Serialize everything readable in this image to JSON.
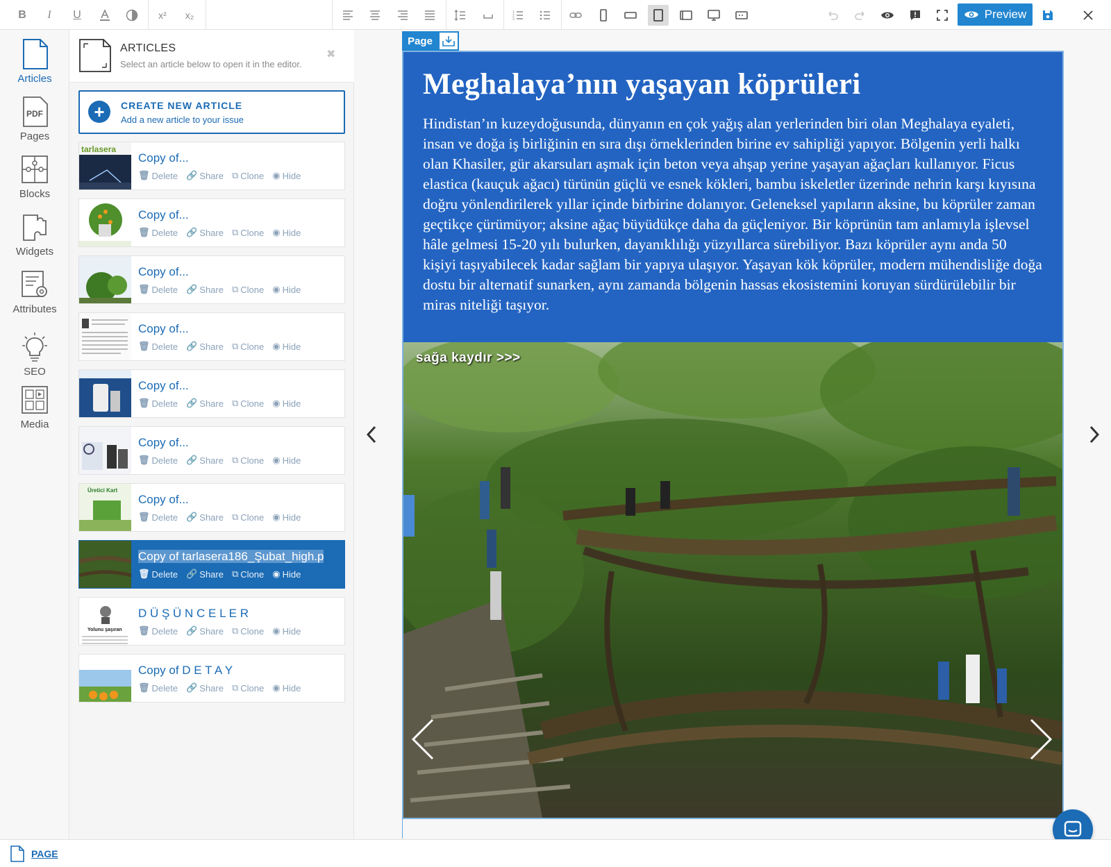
{
  "toolbar": {
    "preview_label": "Preview",
    "colors": {
      "accent": "#2185d0",
      "icon": "#8a8a8a"
    },
    "icons": [
      "bold-icon",
      "italic-icon",
      "underline-icon",
      "font-color-icon",
      "highlight-icon",
      "superscript-icon",
      "subscript-icon",
      "align-left-icon",
      "align-center-icon",
      "align-right-icon",
      "align-justify-icon",
      "line-height-icon",
      "spacing-icon",
      "ordered-list-icon",
      "bullet-list-icon",
      "link-icon",
      "phone-portrait-icon",
      "phone-landscape-icon",
      "tablet-portrait-icon",
      "tablet-landscape-icon",
      "desktop-icon",
      "other-device-icon",
      "undo-icon",
      "redo-icon",
      "eye-icon",
      "comment-icon",
      "fullscreen-icon",
      "save-icon",
      "close-icon"
    ]
  },
  "sidebar": {
    "items": [
      {
        "label": "Articles",
        "icon": "article-doc-icon",
        "active": true
      },
      {
        "label": "Pages",
        "icon": "pdf-icon"
      },
      {
        "label": "Blocks",
        "icon": "puzzle-icon"
      },
      {
        "label": "Widgets",
        "icon": "widget-icon"
      },
      {
        "label": "Attributes",
        "icon": "attributes-icon"
      },
      {
        "label": "SEO",
        "icon": "lightbulb-icon"
      },
      {
        "label": "Media",
        "icon": "media-icon"
      }
    ]
  },
  "articles": {
    "title": "ARTICLES",
    "subtitle": "Select an article below to open it in the editor.",
    "create_title": "CREATE NEW ARTICLE",
    "create_subtitle": "Add a new article to your issue",
    "actions": {
      "delete": "Delete",
      "share": "Share",
      "clone": "Clone",
      "hide": "Hide"
    },
    "items": [
      {
        "name": "Copy of...",
        "thumb": "night-lightning"
      },
      {
        "name": "Copy of...",
        "thumb": "orange-tree"
      },
      {
        "name": "Copy of...",
        "thumb": "green-tree"
      },
      {
        "name": "Copy of...",
        "thumb": "text-page"
      },
      {
        "name": "Copy of...",
        "thumb": "blue-product"
      },
      {
        "name": "Copy of...",
        "thumb": "machine-page"
      },
      {
        "name": "Copy of...",
        "thumb": "green-product"
      },
      {
        "name": "Copy of tarlasera186_Şubat_high.p",
        "thumb": "root-bridge",
        "selected": true
      },
      {
        "name": "D Ü Ş Ü N C E L E R",
        "thumb": "text-portrait"
      },
      {
        "name": "Copy of D E T A Y",
        "thumb": "oranges-sky"
      }
    ]
  },
  "page": {
    "tag": "Page",
    "heading": "Meghalaya’nın yaşayan köprüleri",
    "body": "Hindistan’ın kuzeydoğusunda, dünyanın en çok yağış alan yerlerinden biri olan Meghalaya eyaleti, insan ve doğa iş birliğinin en sıra dışı örneklerinden birine ev sahipliği yapıyor. Bölgenin yerli halkı olan Khasiler, gür akarsuları aşmak için beton veya ahşap yerine yaşayan ağaçları kullanıyor. Ficus elastica (kauçuk ağacı) türünün güçlü ve esnek kökleri, bambu iskeletler üzerinde nehrin karşı kıyısına doğru yönlendirilerek yıllar içinde birbirine dolanıyor. Geleneksel yapıların aksine, bu köprüler zaman geçtikçe çürümüyor; aksine ağaç büyüdükçe daha da güçleniyor. Bir köprünün tam anlamıyla işlevsel hâle gelmesi 15-20 yılı bulurken, dayanıklılığı yüzyıllarca sürebiliyor. Bazı köprüler aynı anda 50 kişiyi taşıyabilecek kadar sağlam bir yapıya ulaşıyor. Yaşayan kök köprüler, modern mühendisliğe doğa dostu bir alternatif sunarken, aynı zamanda bölgenin hassas ekosistemini koruyan sürdürülebilir bir miras niteliği taşıyor.",
    "swipe_hint": "sağa kaydır >>>",
    "hero_color": "#2364c2"
  },
  "statusbar": {
    "page_label": "PAGE"
  }
}
